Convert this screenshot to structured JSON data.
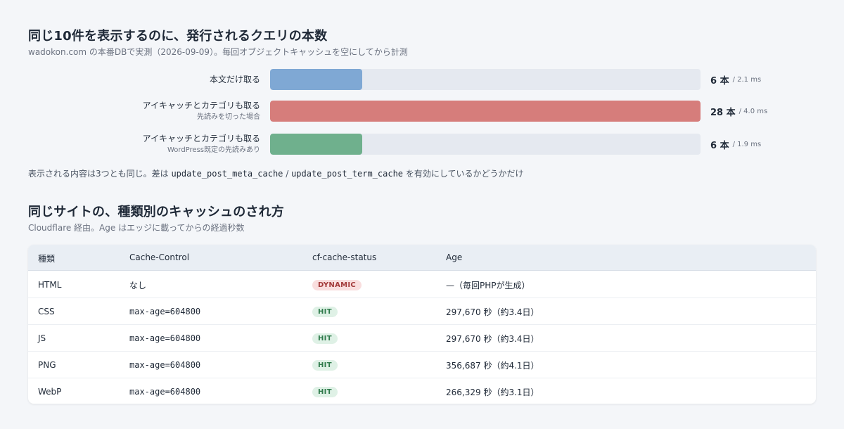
{
  "section1": {
    "title": "同じ10件を表示するのに、発行されるクエリの本数",
    "subtitle": "wadokon.com の本番DBで実測（2026-09-09）。毎回オブジェクトキャッシュを空にしてから計測",
    "footnote_prefix": "表示される内容は3つとも同じ。差は ",
    "footnote_code1": "update_post_meta_cache",
    "footnote_sep": " / ",
    "footnote_code2": "update_post_term_cache",
    "footnote_suffix": " を有効にしているかどうかだけ"
  },
  "chart_data": {
    "type": "bar",
    "orientation": "horizontal",
    "title": "同じ10件を表示するのに、発行されるクエリの本数",
    "subtitle": "wadokon.com の本番DBで実測（2026-09-09）。毎回オブジェクトキャッシュを空にしてから計測",
    "xlim": [
      0,
      28
    ],
    "unit": "本",
    "bars": [
      {
        "label": "本文だけ取る",
        "note": "",
        "value": 6,
        "value_label": "6 本",
        "time_label": "/ 2.1 ms",
        "color": "#7fa8d4"
      },
      {
        "label": "アイキャッチとカテゴリも取る",
        "note": "先読みを切った場合",
        "value": 28,
        "value_label": "28 本",
        "time_label": "/ 4.0 ms",
        "color": "#d67d7b"
      },
      {
        "label": "アイキャッチとカテゴリも取る",
        "note": "WordPress既定の先読みあり",
        "value": 6,
        "value_label": "6 本",
        "time_label": "/ 1.9 ms",
        "color": "#6fb08d"
      }
    ]
  },
  "section2": {
    "title": "同じサイトの、種類別のキャッシュのされ方",
    "subtitle": "Cloudflare 経由。Age はエッジに載ってからの経過秒数",
    "headers": [
      "種類",
      "Cache-Control",
      "cf-cache-status",
      "Age"
    ],
    "rows": [
      {
        "type": "HTML",
        "cache_control": "なし",
        "status": "DYNAMIC",
        "status_bg": "#f9dede",
        "status_fg": "#a33a3a",
        "age": "—（毎回PHPが生成）"
      },
      {
        "type": "CSS",
        "cache_control": "max-age=604800",
        "status": "HIT",
        "status_bg": "#dff1e6",
        "status_fg": "#2f7a4b",
        "age": "297,670 秒（約3.4日）"
      },
      {
        "type": "JS",
        "cache_control": "max-age=604800",
        "status": "HIT",
        "status_bg": "#dff1e6",
        "status_fg": "#2f7a4b",
        "age": "297,670 秒（約3.4日）"
      },
      {
        "type": "PNG",
        "cache_control": "max-age=604800",
        "status": "HIT",
        "status_bg": "#dff1e6",
        "status_fg": "#2f7a4b",
        "age": "356,687 秒（約4.1日）"
      },
      {
        "type": "WebP",
        "cache_control": "max-age=604800",
        "status": "HIT",
        "status_bg": "#dff1e6",
        "status_fg": "#2f7a4b",
        "age": "266,329 秒（約3.1日）"
      }
    ]
  }
}
